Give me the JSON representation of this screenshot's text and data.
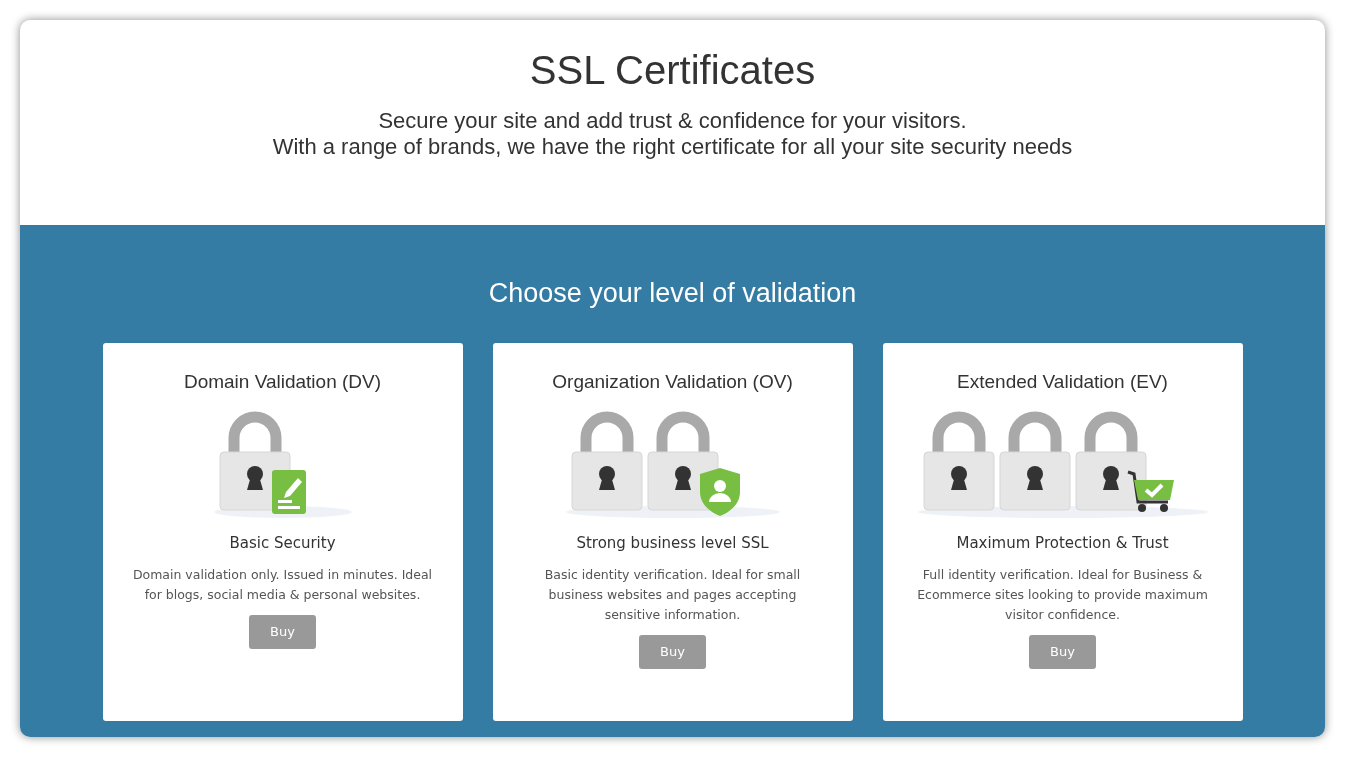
{
  "header": {
    "title": "SSL Certificates",
    "subtitle_lines": [
      "Secure your site and add trust & confidence for your visitors.",
      "With a range of brands, we have the right certificate for all your site security needs"
    ]
  },
  "section": {
    "title": "Choose your level of validation"
  },
  "plans": [
    {
      "kind": "dv",
      "title": "Domain Validation (DV)",
      "tagline": "Basic Security",
      "description": "Domain validation only. Issued in minutes. Ideal for blogs, social media & personal websites.",
      "button": "Buy"
    },
    {
      "kind": "ov",
      "title": "Organization Validation (OV)",
      "tagline": "Strong business level SSL",
      "description": "Basic identity verification. Ideal for small business websites and pages accepting sensitive information.",
      "button": "Buy"
    },
    {
      "kind": "ev",
      "title": "Extended Validation (EV)",
      "tagline": "Maximum Protection & Trust",
      "description": "Full identity verification. Ideal for Business & Ecommerce sites looking to provide maximum visitor confidence.",
      "button": "Buy"
    }
  ]
}
